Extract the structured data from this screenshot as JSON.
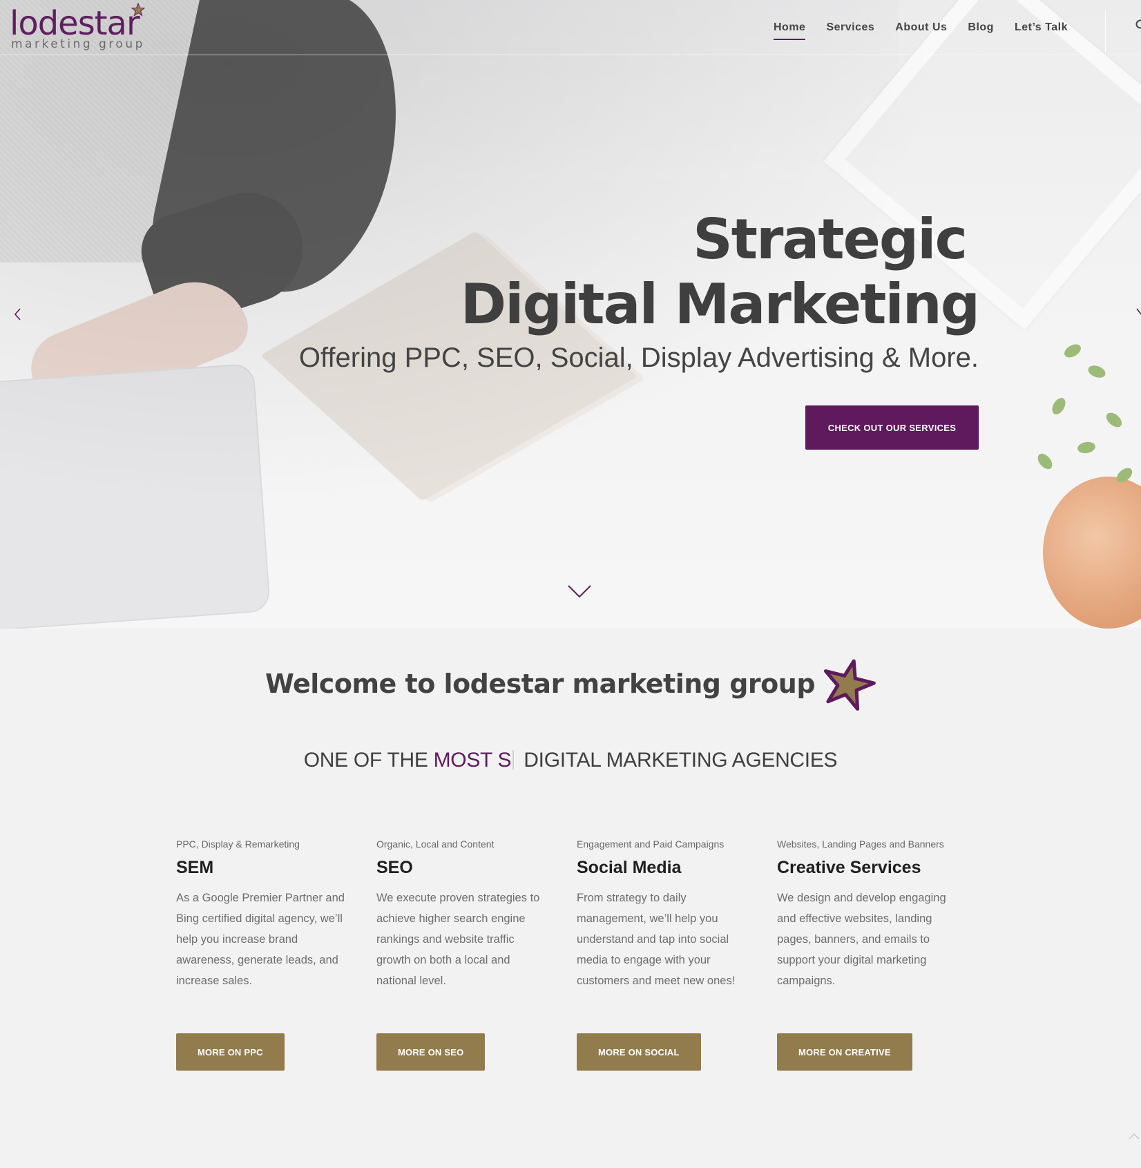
{
  "brand": {
    "logo_word": "lodestar",
    "logo_sub": "marketing group",
    "primary_color": "#5e1a5c",
    "accent_gold": "#927c4e"
  },
  "nav": {
    "items": [
      {
        "label": "Home",
        "active": true
      },
      {
        "label": "Services",
        "active": false
      },
      {
        "label": "About Us",
        "active": false
      },
      {
        "label": "Blog",
        "active": false
      },
      {
        "label": "Let’s Talk",
        "active": false
      }
    ],
    "search_icon": "search-icon"
  },
  "hero": {
    "title_line1": "Strategic",
    "title_line2": "Digital Marketing",
    "subtitle": "Offering PPC, SEO, Social, Display Advertising & More.",
    "cta_label": "CHECK OUT OUR SERVICES",
    "prev_icon": "chevron-left-icon",
    "next_icon": "chevron-right-icon",
    "scroll_icon": "chevron-down-icon"
  },
  "welcome": {
    "title": "Welcome to lodestar marketing group",
    "tagline_before": "ONE OF THE ",
    "tagline_highlight": "MOST S",
    "tagline_after": " DIGITAL MARKETING AGENCIES"
  },
  "services": [
    {
      "eyebrow": "PPC, Display & Remarketing",
      "title": "SEM",
      "body": "As a Google Premier Partner and Bing certified digital agency, we’ll help you increase brand awareness, generate leads, and increase sales.",
      "button": "MORE ON PPC"
    },
    {
      "eyebrow": "Organic, Local and Content",
      "title": "SEO",
      "body": "We execute proven strategies to achieve higher search engine rankings and website traffic growth on both a local and national level.",
      "button": "MORE ON SEO"
    },
    {
      "eyebrow": "Engagement and Paid Campaigns",
      "title": "Social Media",
      "body": "From strategy to daily management, we’ll help you understand and tap into social media to engage with your customers and meet new ones!",
      "button": "MORE ON SOCIAL"
    },
    {
      "eyebrow": "Websites, Landing Pages and Banners",
      "title": "Creative Services",
      "body": "We design and develop engaging and effective websites, landing pages, banners, and emails to support your digital marketing campaigns.",
      "button": "MORE ON CREATIVE"
    }
  ]
}
